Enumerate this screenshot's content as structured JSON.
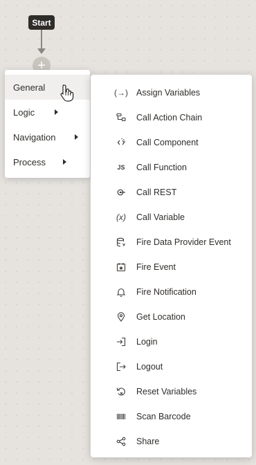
{
  "canvas": {
    "start_label": "Start"
  },
  "menu": {
    "items": [
      {
        "label": "General",
        "icon": "chevron-right-icon"
      },
      {
        "label": "Logic",
        "icon": "chevron-right-icon"
      },
      {
        "label": "Navigation",
        "icon": "chevron-right-icon"
      },
      {
        "label": "Process",
        "icon": "chevron-right-icon"
      }
    ],
    "hovered": "General"
  },
  "submenu": {
    "items": [
      {
        "label": "Assign Variables",
        "icon": "assign-variables-icon",
        "glyph": "(→)"
      },
      {
        "label": "Call Action Chain",
        "icon": "action-chain-icon"
      },
      {
        "label": "Call Component",
        "icon": "component-icon"
      },
      {
        "label": "Call Function",
        "icon": "function-icon",
        "glyph": "JS"
      },
      {
        "label": "Call REST",
        "icon": "rest-icon"
      },
      {
        "label": "Call Variable",
        "icon": "variable-icon",
        "glyph": "(x)"
      },
      {
        "label": "Fire Data Provider Event",
        "icon": "database-icon"
      },
      {
        "label": "Fire Event",
        "icon": "calendar-star-icon"
      },
      {
        "label": "Fire Notification",
        "icon": "bell-icon"
      },
      {
        "label": "Get Location",
        "icon": "location-pin-icon"
      },
      {
        "label": "Login",
        "icon": "login-icon"
      },
      {
        "label": "Logout",
        "icon": "logout-icon"
      },
      {
        "label": "Reset Variables",
        "icon": "reset-icon"
      },
      {
        "label": "Scan Barcode",
        "icon": "barcode-icon"
      },
      {
        "label": "Share",
        "icon": "share-icon"
      }
    ]
  }
}
